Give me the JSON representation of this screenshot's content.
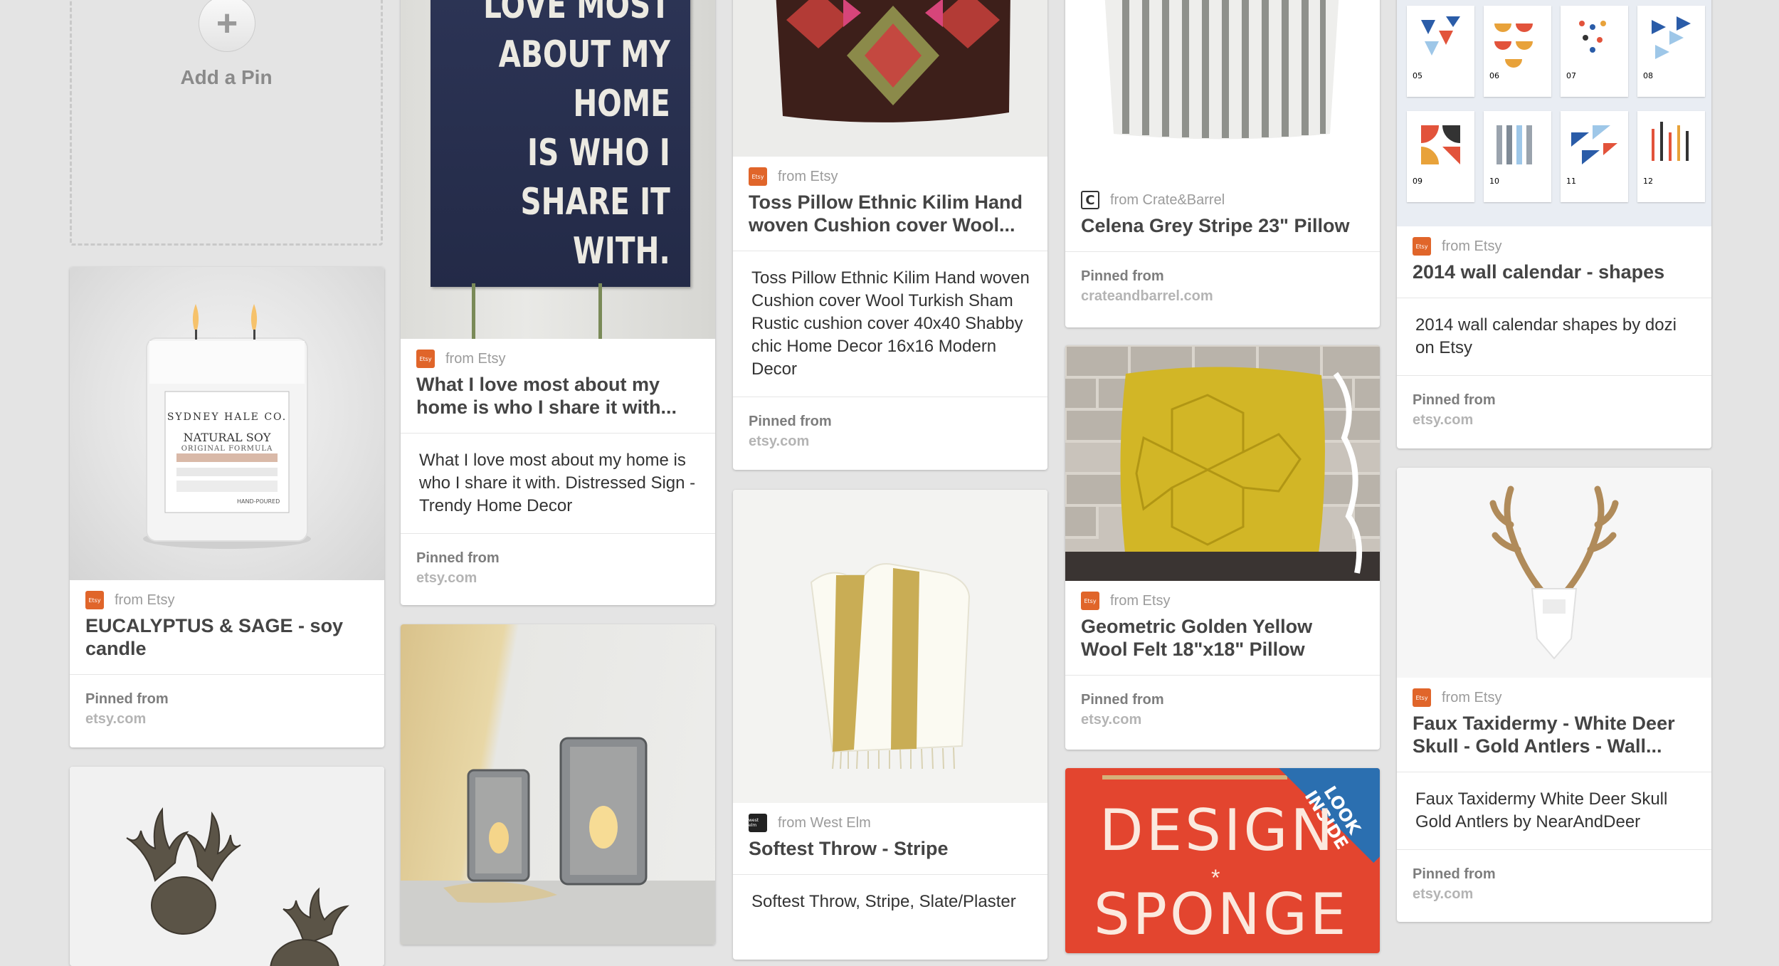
{
  "add_pin": {
    "label": "Add a Pin",
    "icon": "plus-icon"
  },
  "pins": {
    "candle": {
      "source": "from Etsy",
      "title": "EUCALYPTUS & SAGE - soy candle",
      "pinned_label": "Pinned from",
      "site": "etsy.com",
      "image_text": {
        "brand": "SYDNEY HALE CO.",
        "line1": "NATURAL SOY",
        "line2": "ORIGINAL FORMULA",
        "line3": "HAND-POURED"
      }
    },
    "sign": {
      "source": "from Etsy",
      "title": "What I love most about my home is who I share it with...",
      "description": "What I love most about my home is who I share it with. Distressed Sign - Trendy Home Decor",
      "pinned_label": "Pinned from",
      "site": "etsy.com",
      "image_text": [
        "LOVE MOST",
        "ABOUT MY",
        "HOME",
        "IS WHO I",
        "SHARE IT",
        "WITH."
      ]
    },
    "kilim": {
      "source": "from Etsy",
      "title": "Toss Pillow Ethnic Kilim Hand woven Cushion cover Wool...",
      "description": "Toss Pillow Ethnic Kilim Hand woven Cushion cover Wool Turkish Sham Rustic cushion cover 40x40 Shabby chic Home Decor 16x16 Modern Decor",
      "pinned_label": "Pinned from",
      "site": "etsy.com"
    },
    "throw": {
      "source": "from West Elm",
      "title": "Softest Throw - Stripe",
      "description": "Softest Throw, Stripe, Slate/Plaster"
    },
    "stripe_pillow": {
      "source": "from Crate&Barrel",
      "title": "Celena Grey Stripe 23\" Pillow",
      "pinned_label": "Pinned from",
      "site": "crateandbarrel.com"
    },
    "yellow_pillow": {
      "source": "from Etsy",
      "title": "Geometric Golden Yellow Wool Felt 18\"x18\" Pillow",
      "pinned_label": "Pinned from",
      "site": "etsy.com"
    },
    "book": {
      "image_text": {
        "big1": "DESIGN",
        "big2": "SPONGE",
        "corner": "LOOK INSIDE"
      }
    },
    "calendar": {
      "source": "from Etsy",
      "title": "2014 wall calendar - shapes",
      "description": "2014 wall calendar shapes by dozi on Etsy",
      "pinned_label": "Pinned from",
      "site": "etsy.com",
      "months": [
        "05",
        "06",
        "07",
        "08",
        "09",
        "10",
        "11",
        "12"
      ]
    },
    "antlers": {
      "source": "from Etsy",
      "title": "Faux Taxidermy - White Deer Skull - Gold Antlers - Wall...",
      "description": "Faux Taxidermy White Deer Skull Gold Antlers by NearAndDeer",
      "pinned_label": "Pinned from",
      "site": "etsy.com"
    }
  },
  "source_logos": {
    "etsy": "Etsy",
    "crate": "C",
    "westelm": "west elm"
  },
  "colors": {
    "etsy_orange": "#e0652a",
    "background": "#e4e4e4"
  }
}
